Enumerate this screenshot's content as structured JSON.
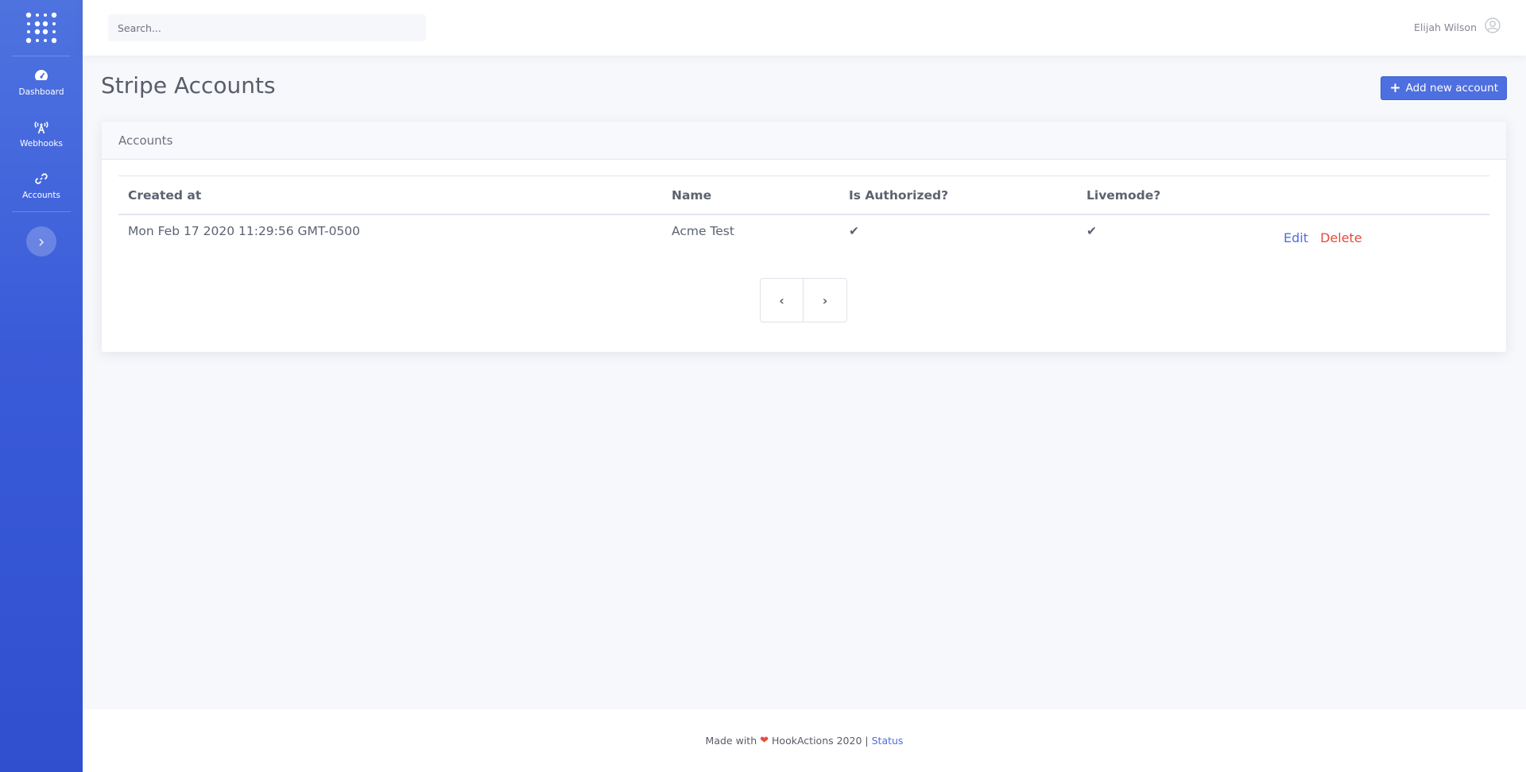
{
  "sidebar": {
    "logo_icon": "dot-grid-logo",
    "items": [
      {
        "label": "Dashboard",
        "icon": "tachometer-icon"
      },
      {
        "label": "Webhooks",
        "icon": "broadcast-icon"
      },
      {
        "label": "Accounts",
        "icon": "link-icon"
      }
    ],
    "toggle_icon": "chevron-right-icon"
  },
  "topbar": {
    "search_placeholder": "Search...",
    "user_name": "Elijah Wilson",
    "user_icon": "user-circle-icon"
  },
  "page": {
    "title": "Stripe Accounts",
    "add_button_label": "Add new account",
    "add_button_icon": "plus-icon"
  },
  "card": {
    "header": "Accounts",
    "columns": [
      "Created at",
      "Name",
      "Is Authorized?",
      "Livemode?",
      ""
    ],
    "rows": [
      {
        "created_at": "Mon Feb 17 2020 11:29:56 GMT-0500",
        "name": "Acme Test",
        "is_authorized": "✔",
        "livemode": "✔",
        "edit_label": "Edit",
        "delete_label": "Delete"
      }
    ],
    "pager": {
      "prev": "‹",
      "next": "›"
    }
  },
  "footer": {
    "made_with": "Made with",
    "heart": "❤",
    "brand": "HookActions 2020 |",
    "status_link": "Status"
  },
  "colors": {
    "sidebar_top": "#4e73df",
    "sidebar_bottom": "#2f4fcf",
    "primary": "#4e6fe0",
    "danger": "#e74a3b"
  }
}
